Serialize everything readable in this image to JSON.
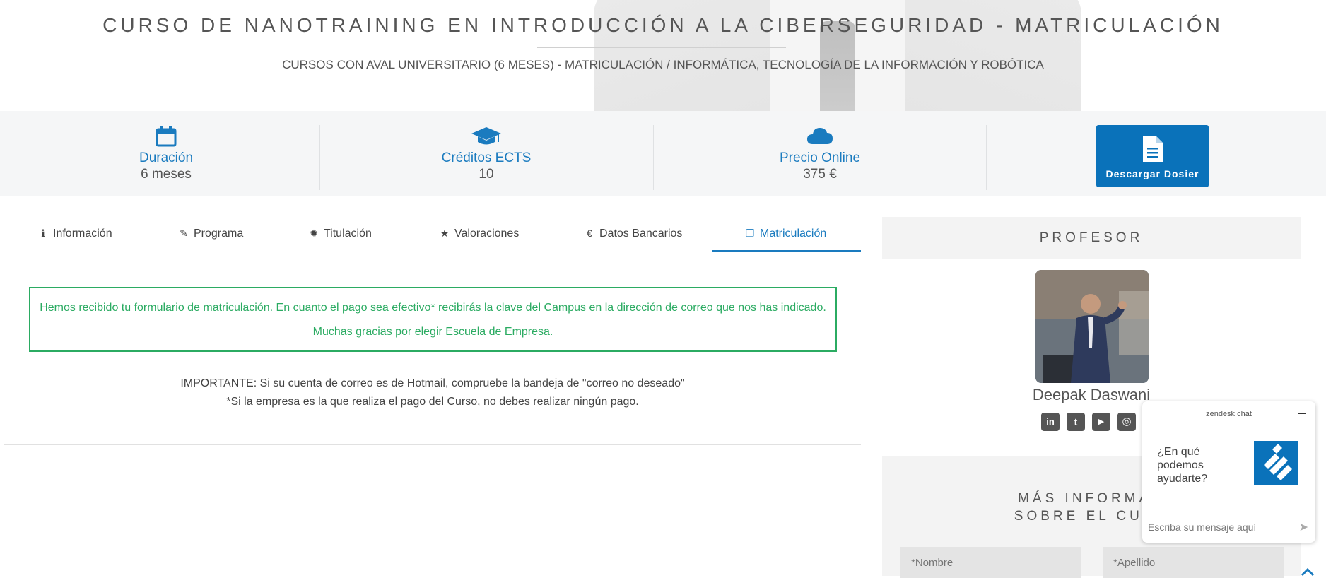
{
  "hero": {
    "title": "CURSO DE NANOTRAINING EN INTRODUCCIÓN A LA CIBERSEGURIDAD - MATRICULACIÓN",
    "subtitle": "CURSOS CON AVAL UNIVERSITARIO (6 MESES) - MATRICULACIÓN / INFORMÁTICA, TECNOLOGÍA DE LA INFORMACIÓN Y ROBÓTICA"
  },
  "info": [
    {
      "icon": "calendar-icon",
      "label": "Duración",
      "value": "6 meses"
    },
    {
      "icon": "graduation-cap-icon",
      "label": "Créditos ECTS",
      "value": "10"
    },
    {
      "icon": "cloud-icon",
      "label": "Precio Online",
      "value": "375 €"
    }
  ],
  "download": {
    "icon": "document-icon",
    "label": "Descargar Dosier"
  },
  "tabs": [
    {
      "icon": "info-circle-icon",
      "glyph": "ℹ",
      "label": "Información",
      "active": false
    },
    {
      "icon": "paperclip-icon",
      "glyph": "✎",
      "label": "Programa",
      "active": false
    },
    {
      "icon": "certificate-icon",
      "glyph": "✹",
      "label": "Titulación",
      "active": false
    },
    {
      "icon": "star-icon",
      "glyph": "★",
      "label": "Valoraciones",
      "active": false
    },
    {
      "icon": "euro-icon",
      "glyph": "€",
      "label": "Datos Bancarios",
      "active": false
    },
    {
      "icon": "copy-icon",
      "glyph": "❐",
      "label": "Matriculación",
      "active": true
    }
  ],
  "notice": {
    "line1": "Hemos recibido tu formulario de matriculación. En cuanto el pago sea efectivo* recibirás la clave del Campus en la dirección de correo que nos has indicado.",
    "line2": "Muchas gracias por elegir Escuela de Empresa."
  },
  "important": {
    "line1": "IMPORTANTE: Si su cuenta de correo es de Hotmail, compruebe la bandeja de \"correo no deseado\"",
    "line2": "*Si la empresa es la que realiza el pago del Curso, no debes realizar ningún pago."
  },
  "professor": {
    "heading": "PROFESOR",
    "name": "Deepak Daswani",
    "social": [
      {
        "icon": "linkedin-icon",
        "glyph": "in"
      },
      {
        "icon": "twitter-icon",
        "glyph": "t"
      },
      {
        "icon": "youtube-icon",
        "glyph": "▶"
      },
      {
        "icon": "instagram-icon",
        "glyph": "◎"
      }
    ]
  },
  "more_info": {
    "title_line1": "MÁS INFORMAC",
    "title_line2": "SOBRE EL CURS",
    "name_placeholder": "*Nombre",
    "surname_placeholder": "*Apellido"
  },
  "chat": {
    "brand": "zendesk chat",
    "minimize": "–",
    "question": "¿En qué podemos ayudarte?",
    "input_placeholder": "Escriba su mensaje aquí",
    "send": "➤"
  },
  "colors": {
    "accent": "#1a7bbf",
    "button": "#0a72ba",
    "success": "#2bab62"
  }
}
